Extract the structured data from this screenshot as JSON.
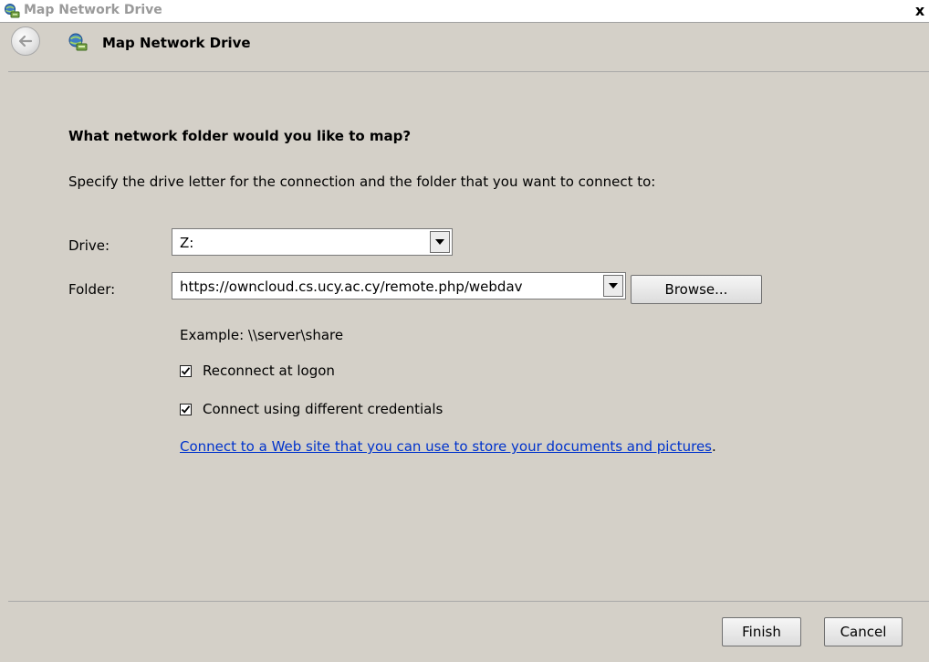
{
  "window": {
    "title": "Map Network Drive",
    "close_glyph": "x"
  },
  "header": {
    "title": "Map Network Drive",
    "back_icon": "back-arrow-icon",
    "app_icon": "network-drive-icon"
  },
  "wizard": {
    "question": "What network folder would you like to map?",
    "instruction": "Specify the drive letter for the connection and the folder that you want to connect to:",
    "drive": {
      "label": "Drive:",
      "value": "Z:"
    },
    "folder": {
      "label": "Folder:",
      "value": "https://owncloud.cs.ucy.ac.cy/remote.php/webdav",
      "browse_label": "Browse..."
    },
    "example": "Example: \\\\server\\share",
    "reconnect": {
      "label": "Reconnect at logon",
      "checked": true
    },
    "credentials": {
      "label": "Connect using different credentials",
      "checked": true
    },
    "link_text": "Connect to a Web site that you can use to store your documents and pictures",
    "link_suffix": "."
  },
  "footer": {
    "finish_label": "Finish",
    "cancel_label": "Cancel"
  },
  "colors": {
    "dialog_bg": "#d4d0c8",
    "link": "#0033cc",
    "title_text": "#9a9a9a"
  }
}
